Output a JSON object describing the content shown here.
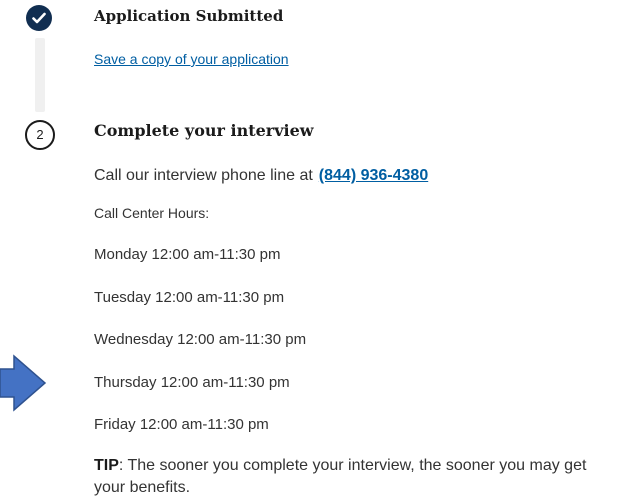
{
  "steps": [
    {
      "status": "done",
      "icon": "check-icon",
      "title": "Application Submitted",
      "link_text": "Save a copy of your application"
    },
    {
      "status": "current",
      "number": "2",
      "title": "Complete your interview",
      "call_text": "Call our interview phone line at",
      "phone": "(844) 936-4380",
      "hours_heading": "Call Center Hours:",
      "hours": [
        "Monday 12:00 am-11:30 pm",
        "Tuesday 12:00 am-11:30 pm",
        "Wednesday 12:00 am-11:30 pm",
        "Thursday 12:00 am-11:30 pm",
        "Friday 12:00 am-11:30 pm"
      ],
      "tip_label": "TIP",
      "tip_text": ": The sooner you complete your interview, the sooner you may get your benefits."
    }
  ],
  "annotation": {
    "icon": "arrow-right-icon",
    "color": "#4472c4"
  },
  "colors": {
    "step_done": "#112e51",
    "link": "#005ea2",
    "text": "#333333"
  }
}
